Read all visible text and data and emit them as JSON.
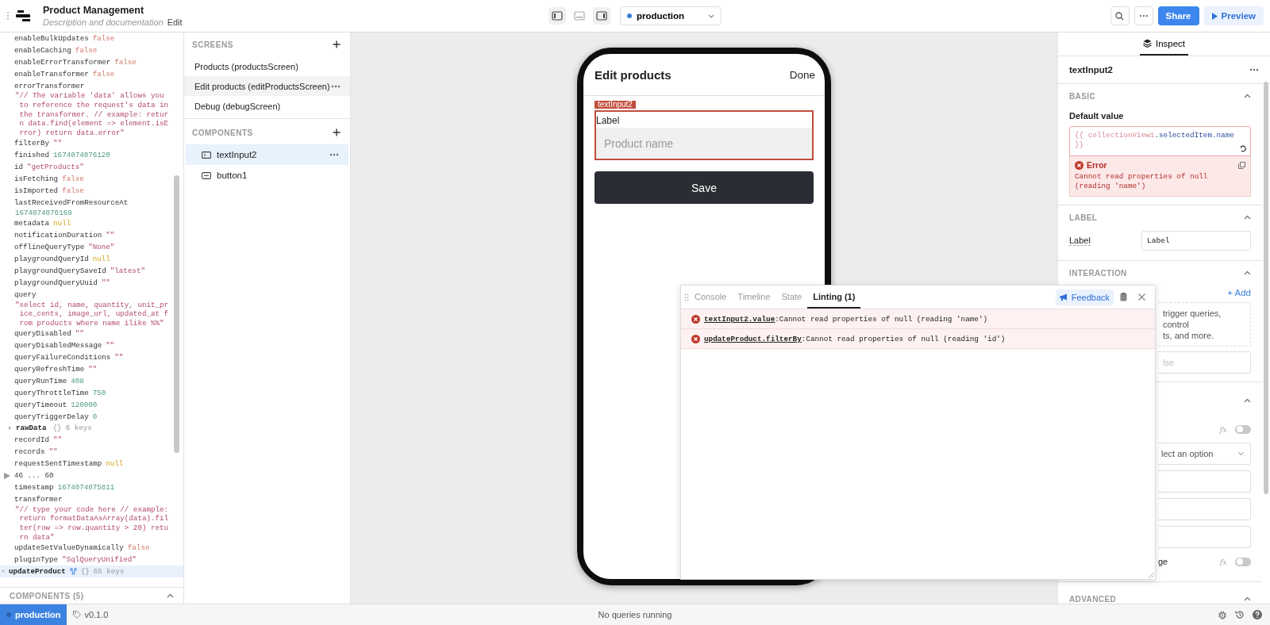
{
  "header": {
    "title": "Product Management",
    "description": "Description and documentation",
    "edit_link": "Edit"
  },
  "toolbar": {
    "layout_toggles": [
      {
        "kind": "left",
        "selected": true
      },
      {
        "kind": "bottom",
        "selected": false
      },
      {
        "kind": "right",
        "selected": true
      }
    ],
    "environment": "production",
    "share": "Share",
    "preview": "Preview"
  },
  "state_tree": {
    "rows": [
      {
        "kind": "boolean",
        "key": "enableBulkUpdates",
        "value": "false"
      },
      {
        "kind": "boolean",
        "key": "enableCaching",
        "value": "false"
      },
      {
        "kind": "boolean",
        "key": "enableErrorTransformer",
        "value": "false"
      },
      {
        "kind": "boolean",
        "key": "enableTransformer",
        "value": "false"
      },
      {
        "kind": "string",
        "key": "errorTransformer",
        "value": "\"// The variable 'data' allows you to reference the request's data in the transformer. // example: return data.find(element => element.isError) return data.error\"",
        "wrapped": true
      },
      {
        "kind": "string",
        "key": "filterBy",
        "value": "\"\""
      },
      {
        "kind": "number",
        "key": "finished",
        "value": "1674074076120"
      },
      {
        "kind": "string",
        "key": "id",
        "value": "\"getProducts\""
      },
      {
        "kind": "boolean",
        "key": "isFetching",
        "value": "false"
      },
      {
        "kind": "boolean",
        "key": "isImported",
        "value": "false"
      },
      {
        "kind": "number",
        "key": "lastReceivedFromResourceAt",
        "value": "1674074076169",
        "wrapped": true
      },
      {
        "kind": "null",
        "key": "metadata",
        "value": "null"
      },
      {
        "kind": "string",
        "key": "notificationDuration",
        "value": "\"\""
      },
      {
        "kind": "string",
        "key": "offlineQueryType",
        "value": "\"None\""
      },
      {
        "kind": "null",
        "key": "playgroundQueryId",
        "value": "null"
      },
      {
        "kind": "string",
        "key": "playgroundQuerySaveId",
        "value": "\"latest\""
      },
      {
        "kind": "string",
        "key": "playgroundQueryUuid",
        "value": "\"\""
      },
      {
        "kind": "string",
        "key": "query",
        "value": "\"select id, name, quantity, unit_price_cents, image_url, updated_at from products where name ilike %%\"",
        "wrapped": true
      },
      {
        "kind": "string",
        "key": "queryDisabled",
        "value": "\"\""
      },
      {
        "kind": "string",
        "key": "queryDisabledMessage",
        "value": "\"\""
      },
      {
        "kind": "string",
        "key": "queryFailureConditions",
        "value": "\"\""
      },
      {
        "kind": "string",
        "key": "queryRefreshTime",
        "value": "\"\""
      },
      {
        "kind": "number",
        "key": "queryRunTime",
        "value": "408"
      },
      {
        "kind": "number",
        "key": "queryThrottleTime",
        "value": "750"
      },
      {
        "kind": "number",
        "key": "queryTimeout",
        "value": "120000"
      },
      {
        "kind": "number",
        "key": "queryTriggerDelay",
        "value": "0"
      },
      {
        "kind": "group",
        "key": "rawData",
        "value": "{}",
        "count": "6 keys",
        "expanded": false
      },
      {
        "kind": "string",
        "key": "recordId",
        "value": "\"\""
      },
      {
        "kind": "string",
        "key": "records",
        "value": "\"\""
      },
      {
        "kind": "null",
        "key": "requestSentTimestamp",
        "value": "null"
      },
      {
        "kind": "range",
        "label": "46 ... 60"
      },
      {
        "kind": "number",
        "key": "timestamp",
        "value": "1674074075811"
      },
      {
        "kind": "string",
        "key": "transformer",
        "value": "\"// type your code here // example: return formatDataAsArray(data).filter(row => row.quantity > 20) return data\"",
        "wrapped": true
      },
      {
        "kind": "boolean",
        "key": "updateSetValueDynamically",
        "value": "false"
      },
      {
        "kind": "string",
        "key": "pluginType",
        "value": "\"SqlQueryUnified\""
      },
      {
        "kind": "root",
        "key": "updateProduct",
        "value": "{}",
        "count": "65 keys",
        "selected": true
      }
    ],
    "components_heading": "COMPONENTS (5)"
  },
  "screens_panel": {
    "screens_heading": "SCREENS",
    "screens": [
      {
        "label": "Products (productsScreen)",
        "selected": false
      },
      {
        "label": "Edit products (editProductsScreen)",
        "selected": true
      },
      {
        "label": "Debug (debugScreen)",
        "selected": false
      }
    ],
    "components_heading": "COMPONENTS",
    "components": [
      {
        "label": "textInput2",
        "kind": "text-input",
        "selected": true
      },
      {
        "label": "button1",
        "kind": "button",
        "selected": false
      }
    ]
  },
  "phone": {
    "title": "Edit products",
    "done": "Done",
    "component_tag": "textInput2",
    "field_label": "Label",
    "placeholder": "Product name",
    "button": "Save"
  },
  "debug_panel": {
    "tabs": [
      {
        "label": "Console",
        "selected": false
      },
      {
        "label": "Timeline",
        "selected": false
      },
      {
        "label": "State",
        "selected": false
      },
      {
        "label": "Linting (1)",
        "selected": true
      }
    ],
    "feedback": "Feedback",
    "errors": [
      {
        "path": "textInput2.value",
        "message": ":Cannot read properties of null (reading 'name')"
      },
      {
        "path": "updateProduct.filterBy",
        "message": ":Cannot read properties of null (reading 'id')"
      }
    ]
  },
  "inspector": {
    "tab": "Inspect",
    "component": "textInput2",
    "basic": {
      "heading": "BASIC",
      "default_value_label": "Default value",
      "code": [
        {
          "text": "{{ ",
          "kind": "brace"
        },
        {
          "text": "collectionView1",
          "kind": "ident"
        },
        {
          "text": ".selectedItem.name",
          "kind": "member"
        },
        {
          "text": " }}",
          "kind": "brace"
        }
      ],
      "error_title": "Error",
      "error_message": "Cannot read properties of null (reading 'name')"
    },
    "label_section": {
      "heading": "LABEL",
      "label": "Label",
      "value": "Label"
    },
    "interaction": {
      "heading": "INTERACTION",
      "add": "+ Add",
      "hint_lines": [
        "trigger queries, control",
        "ts, and more."
      ],
      "placeholder": "lse"
    },
    "hidden_section": {
      "toggles": [
        {
          "fx": "fx",
          "on": false
        },
        {
          "label": "ge",
          "fx": "fx",
          "on": false
        }
      ],
      "select_placeholder": "lect an option"
    },
    "advanced": {
      "heading": "ADVANCED"
    }
  },
  "status_bar": {
    "environment": "production",
    "version": "v0.1.0",
    "message": "No queries running"
  }
}
